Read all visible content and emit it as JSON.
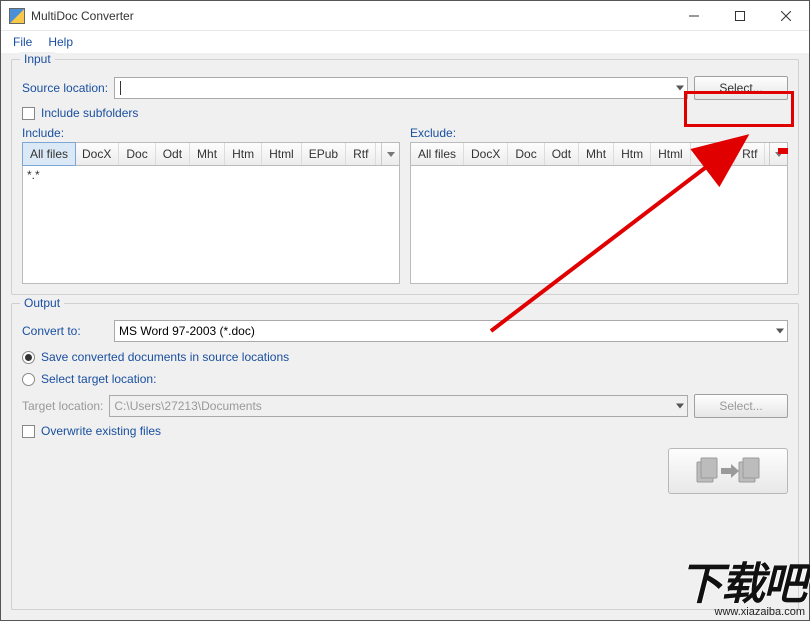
{
  "window": {
    "title": "MultiDoc Converter"
  },
  "menu": {
    "file": "File",
    "help": "Help"
  },
  "input": {
    "legend": "Input",
    "source_label": "Source location:",
    "source_value": "",
    "select_btn": "Select...",
    "include_subfolders": "Include subfolders",
    "include_label": "Include:",
    "exclude_label": "Exclude:",
    "tabs": [
      "All files",
      "DocX",
      "Doc",
      "Odt",
      "Mht",
      "Htm",
      "Html",
      "EPub",
      "Rtf"
    ],
    "include_pattern": "*.*",
    "exclude_pattern": ""
  },
  "output": {
    "legend": "Output",
    "convert_label": "Convert to:",
    "convert_value": "MS Word 97-2003 (*.doc)",
    "save_in_source": "Save converted documents in source locations",
    "select_target": "Select target location:",
    "target_label": "Target location:",
    "target_value": "C:\\Users\\27213\\Documents",
    "target_select_btn": "Select...",
    "overwrite": "Overwrite existing files"
  },
  "watermark": {
    "cn": "下载吧",
    "url": "www.xiazaiba.com"
  }
}
